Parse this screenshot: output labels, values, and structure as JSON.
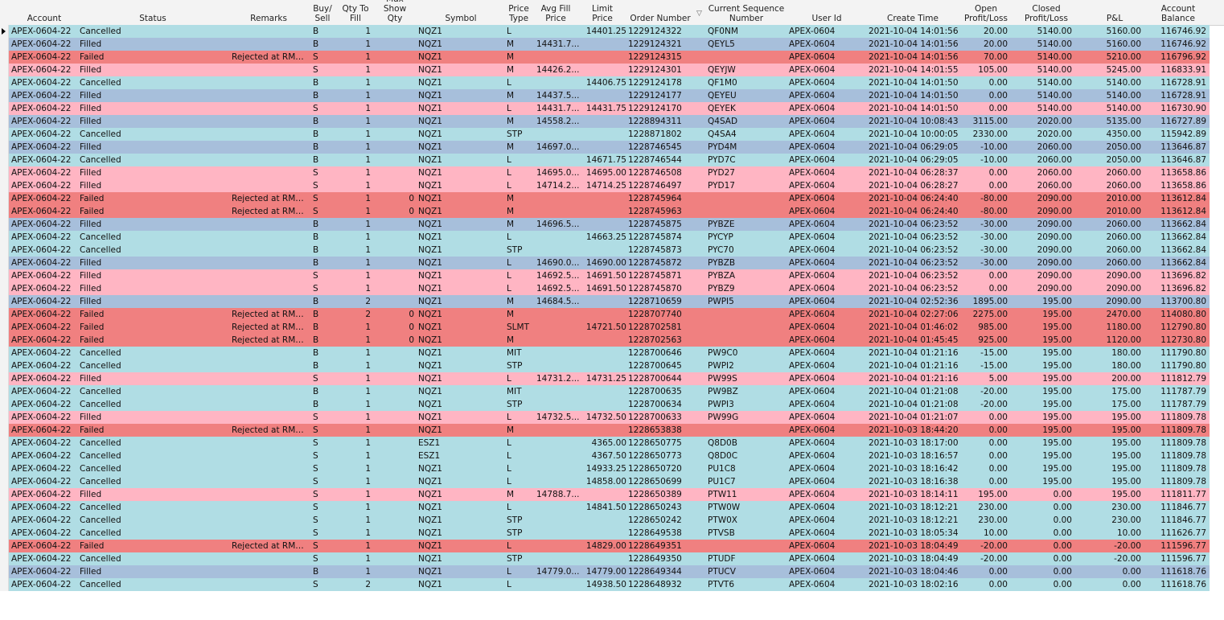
{
  "headers": {
    "account": "Account",
    "status": "Status",
    "remarks": "Remarks",
    "buy_sell": "Buy/\nSell",
    "qty_to_fill": "Qty To\nFill",
    "max_show_qty": "Max\nShow Qty",
    "symbol": "Symbol",
    "price_type": "Price\nType",
    "avg_fill_price": "Avg Fill\nPrice",
    "limit_price": "Limit\nPrice",
    "order_number": "Order Number",
    "current_sequence_number": "Current Sequence\nNumber",
    "user_id": "User Id",
    "create_time": "Create Time",
    "open_pl": "Open\nProfit/Loss",
    "closed_pl": "Closed\nProfit/Loss",
    "pnl": "P&L",
    "account_balance": "Account\nBalance"
  },
  "sort_icon": "sort-descending-icon",
  "colors": {
    "cancelled": "#b0dde4",
    "filled_buy": "#a7bfdb",
    "filled_sell": "#ffb5c3",
    "failed": "#f08080"
  },
  "rows": [
    {
      "acc": "APEX-0604-22",
      "st": "Cancelled",
      "rm": "",
      "bs": "B",
      "q": "1",
      "ms": "",
      "sym": "NQZ1",
      "pt": "L",
      "af": "",
      "lp": "14401.25",
      "on": "1229124322",
      "seq": "QF0NM",
      "uid": "APEX-0604",
      "ct": "2021-10-04 14:01:56",
      "op": "20.00",
      "cp": "5140.00",
      "pl": "5160.00",
      "bal": "116746.92"
    },
    {
      "acc": "APEX-0604-22",
      "st": "Filled",
      "rm": "",
      "bs": "B",
      "q": "1",
      "ms": "",
      "sym": "NQZ1",
      "pt": "M",
      "af": "14431.7...",
      "lp": "",
      "on": "1229124321",
      "seq": "QEYL5",
      "uid": "APEX-0604",
      "ct": "2021-10-04 14:01:56",
      "op": "20.00",
      "cp": "5140.00",
      "pl": "5160.00",
      "bal": "116746.92"
    },
    {
      "acc": "APEX-0604-22",
      "st": "Failed",
      "rm": "Rejected at RMS...",
      "bs": "S",
      "q": "1",
      "ms": "",
      "sym": "NQZ1",
      "pt": "M",
      "af": "",
      "lp": "",
      "on": "1229124315",
      "seq": "",
      "uid": "APEX-0604",
      "ct": "2021-10-04 14:01:56",
      "op": "70.00",
      "cp": "5140.00",
      "pl": "5210.00",
      "bal": "116796.92"
    },
    {
      "acc": "APEX-0604-22",
      "st": "Filled",
      "rm": "",
      "bs": "S",
      "q": "1",
      "ms": "",
      "sym": "NQZ1",
      "pt": "M",
      "af": "14426.2...",
      "lp": "",
      "on": "1229124301",
      "seq": "QEYJW",
      "uid": "APEX-0604",
      "ct": "2021-10-04 14:01:55",
      "op": "105.00",
      "cp": "5140.00",
      "pl": "5245.00",
      "bal": "116833.91"
    },
    {
      "acc": "APEX-0604-22",
      "st": "Cancelled",
      "rm": "",
      "bs": "B",
      "q": "1",
      "ms": "",
      "sym": "NQZ1",
      "pt": "L",
      "af": "",
      "lp": "14406.75",
      "on": "1229124178",
      "seq": "QF1M0",
      "uid": "APEX-0604",
      "ct": "2021-10-04 14:01:50",
      "op": "0.00",
      "cp": "5140.00",
      "pl": "5140.00",
      "bal": "116728.91"
    },
    {
      "acc": "APEX-0604-22",
      "st": "Filled",
      "rm": "",
      "bs": "B",
      "q": "1",
      "ms": "",
      "sym": "NQZ1",
      "pt": "M",
      "af": "14437.5...",
      "lp": "",
      "on": "1229124177",
      "seq": "QEYEU",
      "uid": "APEX-0604",
      "ct": "2021-10-04 14:01:50",
      "op": "0.00",
      "cp": "5140.00",
      "pl": "5140.00",
      "bal": "116728.91"
    },
    {
      "acc": "APEX-0604-22",
      "st": "Filled",
      "rm": "",
      "bs": "S",
      "q": "1",
      "ms": "",
      "sym": "NQZ1",
      "pt": "L",
      "af": "14431.7...",
      "lp": "14431.75",
      "on": "1229124170",
      "seq": "QEYEK",
      "uid": "APEX-0604",
      "ct": "2021-10-04 14:01:50",
      "op": "0.00",
      "cp": "5140.00",
      "pl": "5140.00",
      "bal": "116730.90"
    },
    {
      "acc": "APEX-0604-22",
      "st": "Filled",
      "rm": "",
      "bs": "B",
      "q": "1",
      "ms": "",
      "sym": "NQZ1",
      "pt": "M",
      "af": "14558.2...",
      "lp": "",
      "on": "1228894311",
      "seq": "Q4SAD",
      "uid": "APEX-0604",
      "ct": "2021-10-04 10:08:43",
      "op": "3115.00",
      "cp": "2020.00",
      "pl": "5135.00",
      "bal": "116727.89"
    },
    {
      "acc": "APEX-0604-22",
      "st": "Cancelled",
      "rm": "",
      "bs": "B",
      "q": "1",
      "ms": "",
      "sym": "NQZ1",
      "pt": "STP",
      "af": "",
      "lp": "",
      "on": "1228871802",
      "seq": "Q4SA4",
      "uid": "APEX-0604",
      "ct": "2021-10-04 10:00:05",
      "op": "2330.00",
      "cp": "2020.00",
      "pl": "4350.00",
      "bal": "115942.89"
    },
    {
      "acc": "APEX-0604-22",
      "st": "Filled",
      "rm": "",
      "bs": "B",
      "q": "1",
      "ms": "",
      "sym": "NQZ1",
      "pt": "M",
      "af": "14697.0...",
      "lp": "",
      "on": "1228746545",
      "seq": "PYD4M",
      "uid": "APEX-0604",
      "ct": "2021-10-04 06:29:05",
      "op": "-10.00",
      "cp": "2060.00",
      "pl": "2050.00",
      "bal": "113646.87"
    },
    {
      "acc": "APEX-0604-22",
      "st": "Cancelled",
      "rm": "",
      "bs": "B",
      "q": "1",
      "ms": "",
      "sym": "NQZ1",
      "pt": "L",
      "af": "",
      "lp": "14671.75",
      "on": "1228746544",
      "seq": "PYD7C",
      "uid": "APEX-0604",
      "ct": "2021-10-04 06:29:05",
      "op": "-10.00",
      "cp": "2060.00",
      "pl": "2050.00",
      "bal": "113646.87"
    },
    {
      "acc": "APEX-0604-22",
      "st": "Filled",
      "rm": "",
      "bs": "S",
      "q": "1",
      "ms": "",
      "sym": "NQZ1",
      "pt": "L",
      "af": "14695.0...",
      "lp": "14695.00",
      "on": "1228746508",
      "seq": "PYD27",
      "uid": "APEX-0604",
      "ct": "2021-10-04 06:28:37",
      "op": "0.00",
      "cp": "2060.00",
      "pl": "2060.00",
      "bal": "113658.86"
    },
    {
      "acc": "APEX-0604-22",
      "st": "Filled",
      "rm": "",
      "bs": "S",
      "q": "1",
      "ms": "",
      "sym": "NQZ1",
      "pt": "L",
      "af": "14714.2...",
      "lp": "14714.25",
      "on": "1228746497",
      "seq": "PYD17",
      "uid": "APEX-0604",
      "ct": "2021-10-04 06:28:27",
      "op": "0.00",
      "cp": "2060.00",
      "pl": "2060.00",
      "bal": "113658.86"
    },
    {
      "acc": "APEX-0604-22",
      "st": "Failed",
      "rm": "Rejected at RMS...",
      "bs": "S",
      "q": "1",
      "ms": "0",
      "sym": "NQZ1",
      "pt": "M",
      "af": "",
      "lp": "",
      "on": "1228745964",
      "seq": "",
      "uid": "APEX-0604",
      "ct": "2021-10-04 06:24:40",
      "op": "-80.00",
      "cp": "2090.00",
      "pl": "2010.00",
      "bal": "113612.84"
    },
    {
      "acc": "APEX-0604-22",
      "st": "Failed",
      "rm": "Rejected at RMS...",
      "bs": "S",
      "q": "1",
      "ms": "0",
      "sym": "NQZ1",
      "pt": "M",
      "af": "",
      "lp": "",
      "on": "1228745963",
      "seq": "",
      "uid": "APEX-0604",
      "ct": "2021-10-04 06:24:40",
      "op": "-80.00",
      "cp": "2090.00",
      "pl": "2010.00",
      "bal": "113612.84"
    },
    {
      "acc": "APEX-0604-22",
      "st": "Filled",
      "rm": "",
      "bs": "B",
      "q": "1",
      "ms": "",
      "sym": "NQZ1",
      "pt": "M",
      "af": "14696.5...",
      "lp": "",
      "on": "1228745875",
      "seq": "PYBZE",
      "uid": "APEX-0604",
      "ct": "2021-10-04 06:23:52",
      "op": "-30.00",
      "cp": "2090.00",
      "pl": "2060.00",
      "bal": "113662.84"
    },
    {
      "acc": "APEX-0604-22",
      "st": "Cancelled",
      "rm": "",
      "bs": "B",
      "q": "1",
      "ms": "",
      "sym": "NQZ1",
      "pt": "L",
      "af": "",
      "lp": "14663.25",
      "on": "1228745874",
      "seq": "PYCYP",
      "uid": "APEX-0604",
      "ct": "2021-10-04 06:23:52",
      "op": "-30.00",
      "cp": "2090.00",
      "pl": "2060.00",
      "bal": "113662.84"
    },
    {
      "acc": "APEX-0604-22",
      "st": "Cancelled",
      "rm": "",
      "bs": "B",
      "q": "1",
      "ms": "",
      "sym": "NQZ1",
      "pt": "STP",
      "af": "",
      "lp": "",
      "on": "1228745873",
      "seq": "PYC70",
      "uid": "APEX-0604",
      "ct": "2021-10-04 06:23:52",
      "op": "-30.00",
      "cp": "2090.00",
      "pl": "2060.00",
      "bal": "113662.84"
    },
    {
      "acc": "APEX-0604-22",
      "st": "Filled",
      "rm": "",
      "bs": "B",
      "q": "1",
      "ms": "",
      "sym": "NQZ1",
      "pt": "L",
      "af": "14690.0...",
      "lp": "14690.00",
      "on": "1228745872",
      "seq": "PYBZB",
      "uid": "APEX-0604",
      "ct": "2021-10-04 06:23:52",
      "op": "-30.00",
      "cp": "2090.00",
      "pl": "2060.00",
      "bal": "113662.84"
    },
    {
      "acc": "APEX-0604-22",
      "st": "Filled",
      "rm": "",
      "bs": "S",
      "q": "1",
      "ms": "",
      "sym": "NQZ1",
      "pt": "L",
      "af": "14692.5...",
      "lp": "14691.50",
      "on": "1228745871",
      "seq": "PYBZA",
      "uid": "APEX-0604",
      "ct": "2021-10-04 06:23:52",
      "op": "0.00",
      "cp": "2090.00",
      "pl": "2090.00",
      "bal": "113696.82"
    },
    {
      "acc": "APEX-0604-22",
      "st": "Filled",
      "rm": "",
      "bs": "S",
      "q": "1",
      "ms": "",
      "sym": "NQZ1",
      "pt": "L",
      "af": "14692.5...",
      "lp": "14691.50",
      "on": "1228745870",
      "seq": "PYBZ9",
      "uid": "APEX-0604",
      "ct": "2021-10-04 06:23:52",
      "op": "0.00",
      "cp": "2090.00",
      "pl": "2090.00",
      "bal": "113696.82"
    },
    {
      "acc": "APEX-0604-22",
      "st": "Filled",
      "rm": "",
      "bs": "B",
      "q": "2",
      "ms": "",
      "sym": "NQZ1",
      "pt": "M",
      "af": "14684.5...",
      "lp": "",
      "on": "1228710659",
      "seq": "PWPI5",
      "uid": "APEX-0604",
      "ct": "2021-10-04 02:52:36",
      "op": "1895.00",
      "cp": "195.00",
      "pl": "2090.00",
      "bal": "113700.80"
    },
    {
      "acc": "APEX-0604-22",
      "st": "Failed",
      "rm": "Rejected at RMS...",
      "bs": "B",
      "q": "2",
      "ms": "0",
      "sym": "NQZ1",
      "pt": "M",
      "af": "",
      "lp": "",
      "on": "1228707740",
      "seq": "",
      "uid": "APEX-0604",
      "ct": "2021-10-04 02:27:06",
      "op": "2275.00",
      "cp": "195.00",
      "pl": "2470.00",
      "bal": "114080.80"
    },
    {
      "acc": "APEX-0604-22",
      "st": "Failed",
      "rm": "Rejected at RMS...",
      "bs": "B",
      "q": "1",
      "ms": "0",
      "sym": "NQZ1",
      "pt": "SLMT",
      "af": "",
      "lp": "14721.50",
      "on": "1228702581",
      "seq": "",
      "uid": "APEX-0604",
      "ct": "2021-10-04 01:46:02",
      "op": "985.00",
      "cp": "195.00",
      "pl": "1180.00",
      "bal": "112790.80"
    },
    {
      "acc": "APEX-0604-22",
      "st": "Failed",
      "rm": "Rejected at RMS...",
      "bs": "B",
      "q": "1",
      "ms": "0",
      "sym": "NQZ1",
      "pt": "M",
      "af": "",
      "lp": "",
      "on": "1228702563",
      "seq": "",
      "uid": "APEX-0604",
      "ct": "2021-10-04 01:45:45",
      "op": "925.00",
      "cp": "195.00",
      "pl": "1120.00",
      "bal": "112730.80"
    },
    {
      "acc": "APEX-0604-22",
      "st": "Cancelled",
      "rm": "",
      "bs": "B",
      "q": "1",
      "ms": "",
      "sym": "NQZ1",
      "pt": "MIT",
      "af": "",
      "lp": "",
      "on": "1228700646",
      "seq": "PW9C0",
      "uid": "APEX-0604",
      "ct": "2021-10-04 01:21:16",
      "op": "-15.00",
      "cp": "195.00",
      "pl": "180.00",
      "bal": "111790.80"
    },
    {
      "acc": "APEX-0604-22",
      "st": "Cancelled",
      "rm": "",
      "bs": "B",
      "q": "1",
      "ms": "",
      "sym": "NQZ1",
      "pt": "STP",
      "af": "",
      "lp": "",
      "on": "1228700645",
      "seq": "PWPI2",
      "uid": "APEX-0604",
      "ct": "2021-10-04 01:21:16",
      "op": "-15.00",
      "cp": "195.00",
      "pl": "180.00",
      "bal": "111790.80"
    },
    {
      "acc": "APEX-0604-22",
      "st": "Filled",
      "rm": "",
      "bs": "S",
      "q": "1",
      "ms": "",
      "sym": "NQZ1",
      "pt": "L",
      "af": "14731.2...",
      "lp": "14731.25",
      "on": "1228700644",
      "seq": "PW99S",
      "uid": "APEX-0604",
      "ct": "2021-10-04 01:21:16",
      "op": "5.00",
      "cp": "195.00",
      "pl": "200.00",
      "bal": "111812.79"
    },
    {
      "acc": "APEX-0604-22",
      "st": "Cancelled",
      "rm": "",
      "bs": "B",
      "q": "1",
      "ms": "",
      "sym": "NQZ1",
      "pt": "MIT",
      "af": "",
      "lp": "",
      "on": "1228700635",
      "seq": "PW9BZ",
      "uid": "APEX-0604",
      "ct": "2021-10-04 01:21:08",
      "op": "-20.00",
      "cp": "195.00",
      "pl": "175.00",
      "bal": "111787.79"
    },
    {
      "acc": "APEX-0604-22",
      "st": "Cancelled",
      "rm": "",
      "bs": "B",
      "q": "1",
      "ms": "",
      "sym": "NQZ1",
      "pt": "STP",
      "af": "",
      "lp": "",
      "on": "1228700634",
      "seq": "PWPI3",
      "uid": "APEX-0604",
      "ct": "2021-10-04 01:21:08",
      "op": "-20.00",
      "cp": "195.00",
      "pl": "175.00",
      "bal": "111787.79"
    },
    {
      "acc": "APEX-0604-22",
      "st": "Filled",
      "rm": "",
      "bs": "S",
      "q": "1",
      "ms": "",
      "sym": "NQZ1",
      "pt": "L",
      "af": "14732.5...",
      "lp": "14732.50",
      "on": "1228700633",
      "seq": "PW99G",
      "uid": "APEX-0604",
      "ct": "2021-10-04 01:21:07",
      "op": "0.00",
      "cp": "195.00",
      "pl": "195.00",
      "bal": "111809.78"
    },
    {
      "acc": "APEX-0604-22",
      "st": "Failed",
      "rm": "Rejected at RMS...",
      "bs": "S",
      "q": "1",
      "ms": "",
      "sym": "NQZ1",
      "pt": "M",
      "af": "",
      "lp": "",
      "on": "1228653838",
      "seq": "",
      "uid": "APEX-0604",
      "ct": "2021-10-03 18:44:20",
      "op": "0.00",
      "cp": "195.00",
      "pl": "195.00",
      "bal": "111809.78"
    },
    {
      "acc": "APEX-0604-22",
      "st": "Cancelled",
      "rm": "",
      "bs": "S",
      "q": "1",
      "ms": "",
      "sym": "ESZ1",
      "pt": "L",
      "af": "",
      "lp": "4365.00",
      "on": "1228650775",
      "seq": "Q8D0B",
      "uid": "APEX-0604",
      "ct": "2021-10-03 18:17:00",
      "op": "0.00",
      "cp": "195.00",
      "pl": "195.00",
      "bal": "111809.78"
    },
    {
      "acc": "APEX-0604-22",
      "st": "Cancelled",
      "rm": "",
      "bs": "S",
      "q": "1",
      "ms": "",
      "sym": "ESZ1",
      "pt": "L",
      "af": "",
      "lp": "4367.50",
      "on": "1228650773",
      "seq": "Q8D0C",
      "uid": "APEX-0604",
      "ct": "2021-10-03 18:16:57",
      "op": "0.00",
      "cp": "195.00",
      "pl": "195.00",
      "bal": "111809.78"
    },
    {
      "acc": "APEX-0604-22",
      "st": "Cancelled",
      "rm": "",
      "bs": "S",
      "q": "1",
      "ms": "",
      "sym": "NQZ1",
      "pt": "L",
      "af": "",
      "lp": "14933.25",
      "on": "1228650720",
      "seq": "PU1C8",
      "uid": "APEX-0604",
      "ct": "2021-10-03 18:16:42",
      "op": "0.00",
      "cp": "195.00",
      "pl": "195.00",
      "bal": "111809.78"
    },
    {
      "acc": "APEX-0604-22",
      "st": "Cancelled",
      "rm": "",
      "bs": "S",
      "q": "1",
      "ms": "",
      "sym": "NQZ1",
      "pt": "L",
      "af": "",
      "lp": "14858.00",
      "on": "1228650699",
      "seq": "PU1C7",
      "uid": "APEX-0604",
      "ct": "2021-10-03 18:16:38",
      "op": "0.00",
      "cp": "195.00",
      "pl": "195.00",
      "bal": "111809.78"
    },
    {
      "acc": "APEX-0604-22",
      "st": "Filled",
      "rm": "",
      "bs": "S",
      "q": "1",
      "ms": "",
      "sym": "NQZ1",
      "pt": "M",
      "af": "14788.7...",
      "lp": "",
      "on": "1228650389",
      "seq": "PTW11",
      "uid": "APEX-0604",
      "ct": "2021-10-03 18:14:11",
      "op": "195.00",
      "cp": "0.00",
      "pl": "195.00",
      "bal": "111811.77"
    },
    {
      "acc": "APEX-0604-22",
      "st": "Cancelled",
      "rm": "",
      "bs": "S",
      "q": "1",
      "ms": "",
      "sym": "NQZ1",
      "pt": "L",
      "af": "",
      "lp": "14841.50",
      "on": "1228650243",
      "seq": "PTW0W",
      "uid": "APEX-0604",
      "ct": "2021-10-03 18:12:21",
      "op": "230.00",
      "cp": "0.00",
      "pl": "230.00",
      "bal": "111846.77"
    },
    {
      "acc": "APEX-0604-22",
      "st": "Cancelled",
      "rm": "",
      "bs": "S",
      "q": "1",
      "ms": "",
      "sym": "NQZ1",
      "pt": "STP",
      "af": "",
      "lp": "",
      "on": "1228650242",
      "seq": "PTW0X",
      "uid": "APEX-0604",
      "ct": "2021-10-03 18:12:21",
      "op": "230.00",
      "cp": "0.00",
      "pl": "230.00",
      "bal": "111846.77"
    },
    {
      "acc": "APEX-0604-22",
      "st": "Cancelled",
      "rm": "",
      "bs": "S",
      "q": "1",
      "ms": "",
      "sym": "NQZ1",
      "pt": "STP",
      "af": "",
      "lp": "",
      "on": "1228649538",
      "seq": "PTVSB",
      "uid": "APEX-0604",
      "ct": "2021-10-03 18:05:34",
      "op": "10.00",
      "cp": "0.00",
      "pl": "10.00",
      "bal": "111626.77"
    },
    {
      "acc": "APEX-0604-22",
      "st": "Failed",
      "rm": "Rejected at RMS...",
      "bs": "S",
      "q": "1",
      "ms": "",
      "sym": "NQZ1",
      "pt": "L",
      "af": "",
      "lp": "14829.00",
      "on": "1228649351",
      "seq": "",
      "uid": "APEX-0604",
      "ct": "2021-10-03 18:04:49",
      "op": "-20.00",
      "cp": "0.00",
      "pl": "-20.00",
      "bal": "111596.77"
    },
    {
      "acc": "APEX-0604-22",
      "st": "Cancelled",
      "rm": "",
      "bs": "S",
      "q": "1",
      "ms": "",
      "sym": "NQZ1",
      "pt": "STP",
      "af": "",
      "lp": "",
      "on": "1228649350",
      "seq": "PTUDF",
      "uid": "APEX-0604",
      "ct": "2021-10-03 18:04:49",
      "op": "-20.00",
      "cp": "0.00",
      "pl": "-20.00",
      "bal": "111596.77"
    },
    {
      "acc": "APEX-0604-22",
      "st": "Filled",
      "rm": "",
      "bs": "B",
      "q": "1",
      "ms": "",
      "sym": "NQZ1",
      "pt": "L",
      "af": "14779.0...",
      "lp": "14779.00",
      "on": "1228649344",
      "seq": "PTUCV",
      "uid": "APEX-0604",
      "ct": "2021-10-03 18:04:46",
      "op": "0.00",
      "cp": "0.00",
      "pl": "0.00",
      "bal": "111618.76"
    },
    {
      "acc": "APEX-0604-22",
      "st": "Cancelled",
      "rm": "",
      "bs": "S",
      "q": "2",
      "ms": "",
      "sym": "NQZ1",
      "pt": "L",
      "af": "",
      "lp": "14938.50",
      "on": "1228648932",
      "seq": "PTVT6",
      "uid": "APEX-0604",
      "ct": "2021-10-03 18:02:16",
      "op": "0.00",
      "cp": "0.00",
      "pl": "0.00",
      "bal": "111618.76"
    }
  ]
}
